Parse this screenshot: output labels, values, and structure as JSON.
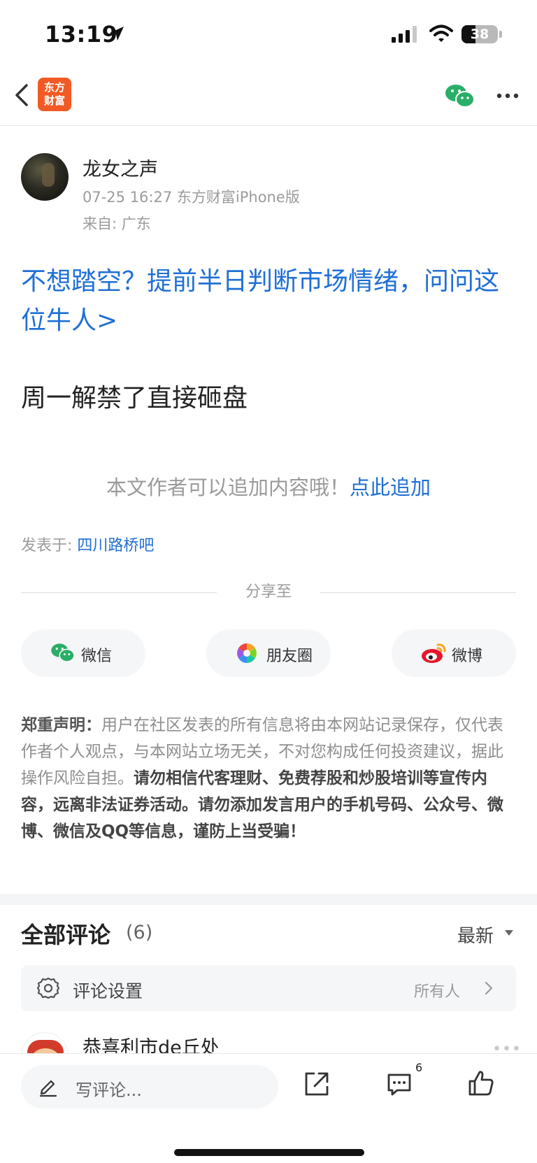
{
  "status_bar": {
    "time": "13:19",
    "battery": "38",
    "battery_level": 0.38
  },
  "nav": {
    "logo_text": "东方\n财富"
  },
  "post": {
    "author_name": "龙女之声",
    "meta": "07-25 16:27 东方财富iPhone版",
    "from": "来自: 广东",
    "promo_link": "不想踏空？提前半日判断市场情绪，问问这位牛人>",
    "body": "周一解禁了直接砸盘",
    "append_text": "本文作者可以追加内容哦！",
    "append_link": "点此追加",
    "posted_in_label": "发表于: ",
    "posted_in_forum": "四川路桥吧"
  },
  "share": {
    "title": "分享至",
    "buttons": [
      {
        "label": "微信",
        "icon": "wechat-icon"
      },
      {
        "label": "朋友圈",
        "icon": "moments-icon"
      },
      {
        "label": "微博",
        "icon": "weibo-icon"
      }
    ]
  },
  "disclaimer": {
    "head": "郑重声明：",
    "normal": "用户在社区发表的所有信息将由本网站记录保存，仅代表作者个人观点，与本网站立场无关，不对您构成任何投资建议，据此操作风险自担。",
    "warning": "请勿相信代客理财、免费荐股和炒股培训等宣传内容，远离非法证券活动。请勿添加发言用户的手机号码、公众号、微博、微信及QQ等信息，谨防上当受骗！"
  },
  "comments": {
    "title": "全部评论",
    "count": "(6)",
    "sort": "最新",
    "settings_label": "评论设置",
    "settings_value": "所有人",
    "first_user": "恭喜利市de丘处",
    "more": "•••"
  },
  "bottom_bar": {
    "placeholder": "写评论...",
    "comment_badge": "6"
  },
  "colors": {
    "link": "#1f6fd6",
    "brand": "#f15a24",
    "wechat": "#2aae67"
  }
}
